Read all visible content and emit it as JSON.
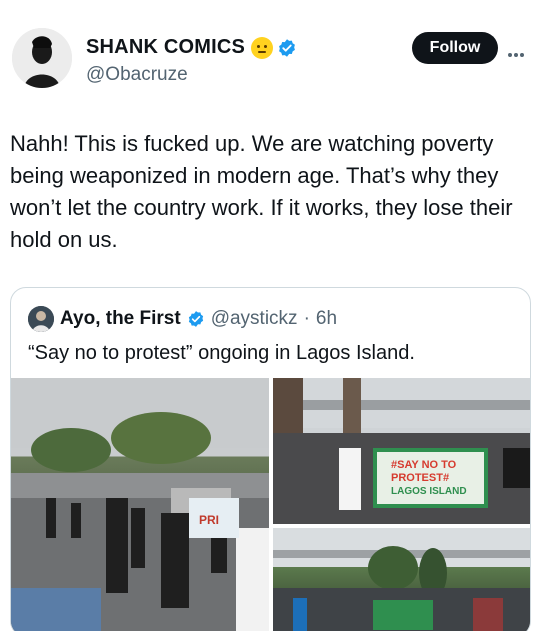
{
  "author": {
    "display_name": "SHANK COMICS",
    "handle": "@Obacruze"
  },
  "follow_label": "Follow",
  "tweet_text": "Nahh! This is fucked up. We are watching poverty being weaponized in modern age. That’s why they won’t let the country work. If it works, they lose their hold on us.",
  "quoted": {
    "display_name": "Ayo, the First",
    "handle": "@aystickz",
    "separator": "·",
    "time": "6h",
    "text": "“Say no to protest” ongoing in Lagos Island."
  },
  "banner_text": {
    "line1": "#SAY NO TO",
    "line2": "PROTEST#",
    "line3": "LAGOS ISLAND",
    "left_sign": "PRI"
  },
  "colors": {
    "verified": "#1d9bf0",
    "follow_bg": "#0f1419",
    "secondary_text": "#536471"
  }
}
